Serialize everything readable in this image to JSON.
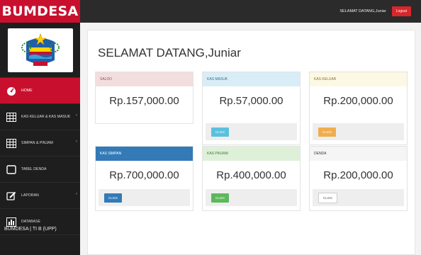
{
  "app": {
    "brand": "BUMDESA"
  },
  "sidebar": {
    "items": [
      {
        "label": "Home",
        "icon": "dashboard-icon",
        "active": true
      },
      {
        "label": "KAS KELUAR & KAS MASUK",
        "icon": "table-icon",
        "has_submenu": true
      },
      {
        "label": "SIMPAN & PINJAM",
        "icon": "table-icon",
        "has_submenu": true
      },
      {
        "label": "TABEL DENDA",
        "icon": "square-icon"
      },
      {
        "label": "LAPORAN",
        "icon": "edit-icon",
        "has_submenu": true
      },
      {
        "label": "DATABASE",
        "icon": "bar-chart-icon"
      }
    ],
    "footer": "BUMDESA | TI B (UPP)"
  },
  "topbar": {
    "welcome": "SELAMAT DATANG,Juniar",
    "logout_label": "Logout"
  },
  "main": {
    "title": "SELAMAT DATANG,Juniar",
    "cards": [
      {
        "title": "SALDO",
        "value": "Rp.157,000.00",
        "header_color": "#f2dede",
        "header_text_color": "#a94442"
      },
      {
        "title": "KAS MASUK",
        "value": "Rp.57,000.00",
        "header_color": "#d9edf7",
        "header_text_color": "#31708f",
        "button_label": "CLICK",
        "button_color": "#5bc0de"
      },
      {
        "title": "KAS KELUAR",
        "value": "Rp.200,000.00",
        "header_color": "#fcf8e3",
        "header_text_color": "#8a6d3b",
        "button_label": "CLICK",
        "button_color": "#f0ad4e"
      },
      {
        "title": "KAS SIMPAN",
        "value": "Rp.700,000.00",
        "header_color": "#337ab7",
        "header_text_color": "#ffffff",
        "button_label": "CLICK",
        "button_color": "#337ab7"
      },
      {
        "title": "KAS PINJAM",
        "value": "Rp.400,000.00",
        "header_color": "#dff0d8",
        "header_text_color": "#3c763d",
        "button_label": "CLICK",
        "button_color": "#5cb85c"
      },
      {
        "title": "DENDA",
        "value": "Rp.200,000.00",
        "header_color": "#f5f5f5",
        "header_text_color": "#333333",
        "button_label": "CLICK",
        "button_color": "#ffffff"
      }
    ]
  }
}
